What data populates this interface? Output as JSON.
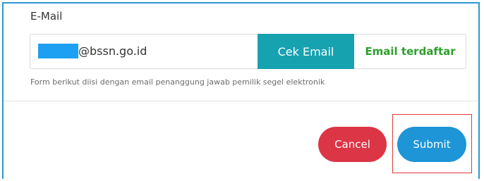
{
  "form": {
    "email_label": "E-Mail",
    "email_value": "@bssn.go.id",
    "check_button_label": "Cek Email",
    "status_text": "Email terdaftar",
    "help_text": "Form berikut diisi dengan email penanggung jawab pemilik segel elektronik"
  },
  "footer": {
    "cancel_label": "Cancel",
    "submit_label": "Submit"
  },
  "colors": {
    "frame_border": "#2a9bd0",
    "check_button": "#17a2b0",
    "status_text": "#2e9e2e",
    "cancel_button": "#dc3545",
    "submit_button": "#1d95d7",
    "highlight_box": "#e03a3a",
    "redaction": "#1ea0f2"
  }
}
